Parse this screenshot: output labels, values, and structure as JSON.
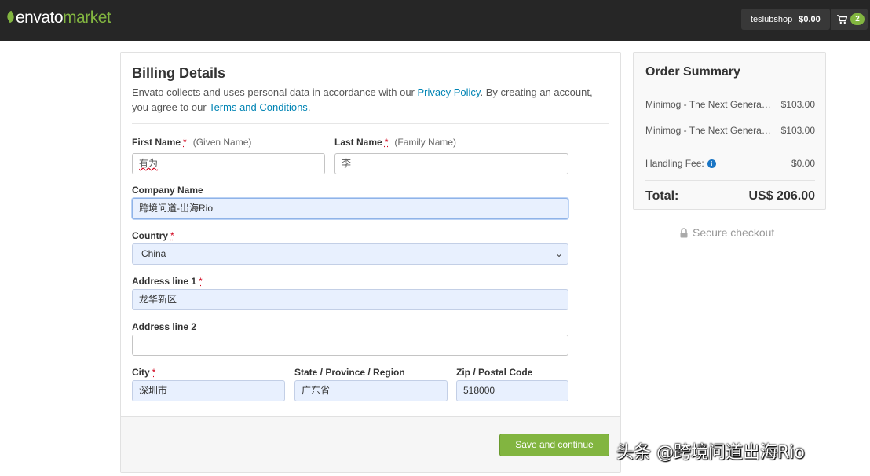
{
  "topbar": {
    "logo_part1": "envato",
    "logo_part2": "market",
    "username": "teslubshop",
    "balance": "$0.00",
    "cart_count": "2",
    "brand_color": "#82b540"
  },
  "billing": {
    "title": "Billing Details",
    "intro_prefix": "Envato collects and uses personal data in accordance with our",
    "privacy_link": "Privacy Policy",
    "intro_middle": ". By creating an account, you agree to our",
    "terms_link": "Terms and Conditions",
    "intro_suffix": ".",
    "required_mark": "*",
    "first_name": {
      "label": "First Name",
      "hint": "(Given Name)",
      "value": "有为"
    },
    "last_name": {
      "label": "Last Name",
      "hint": "(Family Name)",
      "value": "李"
    },
    "company": {
      "label": "Company Name",
      "value": "跨境问道-出海Rio"
    },
    "country": {
      "label": "Country",
      "value": "China"
    },
    "address1": {
      "label": "Address line 1",
      "value": "龙华新区"
    },
    "address2": {
      "label": "Address line 2",
      "value": ""
    },
    "city": {
      "label": "City",
      "value": "深圳市"
    },
    "state": {
      "label": "State / Province / Region",
      "value": "广东省"
    },
    "zip": {
      "label": "Zip / Postal Code",
      "value": "518000"
    },
    "save_label": "Save and continue"
  },
  "summary": {
    "title": "Order Summary",
    "items": [
      {
        "name": "Minimog - The Next Generation Shopify Theme",
        "price": "$103.00"
      },
      {
        "name": "Minimog - The Next Generation Shopify Theme",
        "price": "$103.00"
      }
    ],
    "fee_label": "Handling Fee:",
    "fee_value": "$0.00",
    "total_label": "Total:",
    "total_value": "US$ 206.00"
  },
  "secure_checkout": "Secure checkout",
  "watermark": "头条 @跨境问道出海Rio"
}
